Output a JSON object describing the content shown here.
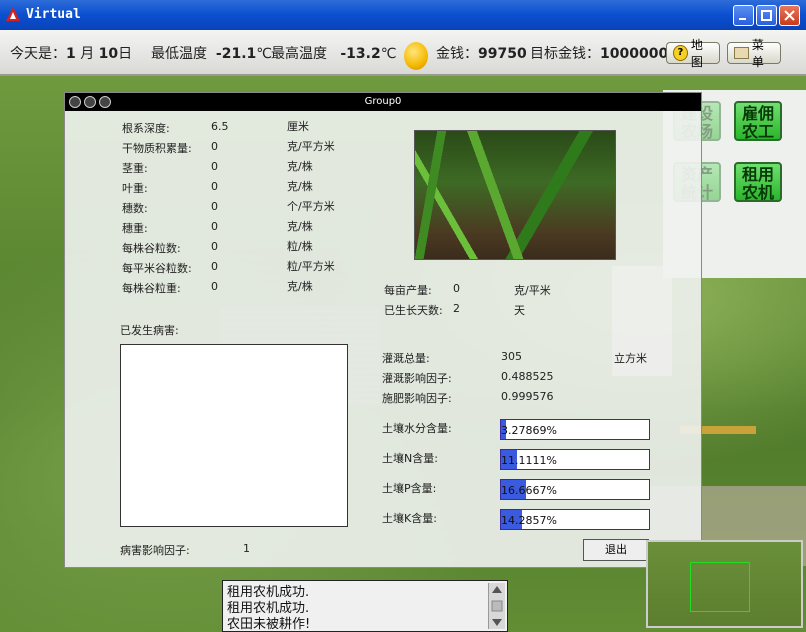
{
  "window": {
    "title": "Virtual"
  },
  "status": {
    "today_label": "今天是：",
    "month": "1",
    "month_unit": "月",
    "day": "10",
    "day_unit": "日",
    "min_temp_label": "最低温度",
    "min_temp": "-21.1",
    "temp_unit": "℃",
    "max_temp_label": "最高温度",
    "max_temp": "-13.2",
    "money_label": "金钱：",
    "money": "99750",
    "target_label": "目标金钱：",
    "target": "1000000",
    "map_button": "地图",
    "menu_button": "菜单"
  },
  "side_buttons": [
    {
      "label_line1": "建设",
      "label_line2": "农场",
      "faded": true
    },
    {
      "label_line1": "雇佣",
      "label_line2": "农工",
      "faded": false
    },
    {
      "label_line1": "资产",
      "label_line2": "统计",
      "faded": true
    },
    {
      "label_line1": "租用",
      "label_line2": "农机",
      "faded": false
    }
  ],
  "dialog": {
    "title": "Group0",
    "stats": [
      {
        "label": "根系深度:",
        "value": "6.5",
        "unit": "厘米"
      },
      {
        "label": "干物质积累量:",
        "value": "0",
        "unit": "克/平方米"
      },
      {
        "label": "茎重:",
        "value": "0",
        "unit": "克/株"
      },
      {
        "label": "叶重:",
        "value": "0",
        "unit": "克/株"
      },
      {
        "label": "穗数:",
        "value": "0",
        "unit": "个/平方米"
      },
      {
        "label": "穗重:",
        "value": "0",
        "unit": "克/株"
      },
      {
        "label": "每株谷粒数:",
        "value": "0",
        "unit": "粒/株"
      },
      {
        "label": "每平米谷粒数:",
        "value": "0",
        "unit": "粒/平方米"
      },
      {
        "label": "每株谷粒重:",
        "value": "0",
        "unit": "克/株"
      }
    ],
    "yield_label": "每亩产量:",
    "yield_value": "0",
    "yield_unit": "克/平米",
    "days_label": "已生长天数:",
    "days_value": "2",
    "days_unit": "天",
    "disease_label": "已发生病害:",
    "irrigation_total_label": "灌溉总量:",
    "irrigation_total": "305",
    "irrigation_unit": "立方米",
    "irrigation_factor_label": "灌溉影响因子:",
    "irrigation_factor": "0.488525",
    "fertilizer_factor_label": "施肥影响因子:",
    "fertilizer_factor": "0.999576",
    "soil": [
      {
        "label": "土壤水分含量:",
        "value": "3.27869%",
        "fraction": 0.0328
      },
      {
        "label": "土壤N含量:",
        "value": "11.1111%",
        "fraction": 0.1111
      },
      {
        "label": "土壤P含量:",
        "value": "16.6667%",
        "fraction": 0.1667
      },
      {
        "label": "土壤K含量:",
        "value": "14.2857%",
        "fraction": 0.1429
      }
    ],
    "disease_factor_label": "病害影响因子:",
    "disease_factor": "1",
    "exit_button": "退出"
  },
  "messages": [
    "租用农机成功.",
    "租用农机成功.",
    "农田未被耕作!"
  ]
}
